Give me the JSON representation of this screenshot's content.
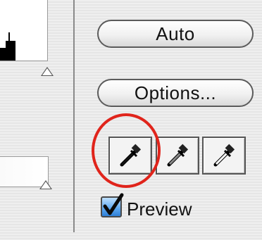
{
  "buttons": {
    "auto_label": "Auto",
    "options_label": "Options..."
  },
  "eyedroppers": [
    {
      "name": "black-point",
      "fill": "#111111"
    },
    {
      "name": "gray-point",
      "fill": "#888888"
    },
    {
      "name": "white-point",
      "fill": "#ffffff"
    }
  ],
  "preview": {
    "label": "Preview",
    "checked": true
  },
  "colors": {
    "highlight": "#e0241b",
    "checkbox_blue": "#2e7fd6"
  }
}
